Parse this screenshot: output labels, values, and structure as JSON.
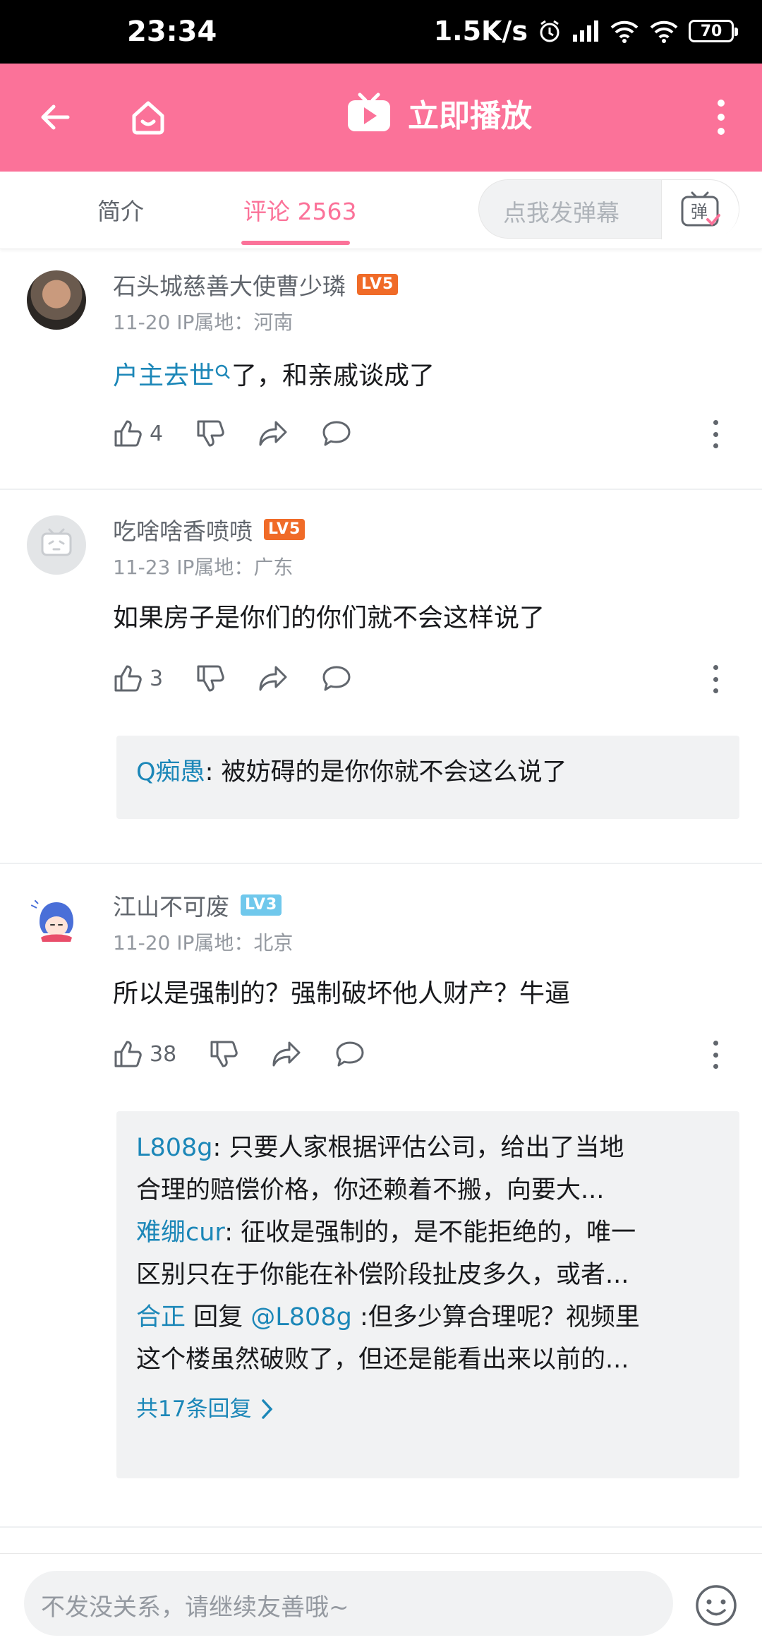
{
  "status_bar": {
    "time": "23:34",
    "net_speed": "1.5K/s",
    "battery": "70"
  },
  "top_bar": {
    "title": "立即播放"
  },
  "tabs": {
    "intro": "简介",
    "comments": "评论 2563",
    "danmaku_placeholder": "点我发弹幕",
    "danmaku_icon_char": "弹"
  },
  "comments": [
    {
      "user": "石头城慈善大使曹少璘",
      "level": "LV5",
      "meta": "11-20  IP属地：河南",
      "content_link": "户主去世",
      "content_rest": "了，和亲戚谈成了",
      "likes": "4"
    },
    {
      "user": "吃啥啥香喷喷",
      "level": "LV5",
      "meta": "11-23  IP属地：广东",
      "content": "如果房子是你们的你们就不会这样说了",
      "likes": "3",
      "replies": [
        {
          "user": "Q痴愚",
          "text": ": 被妨碍的是你你就不会这么说了"
        }
      ]
    },
    {
      "user": "江山不可废",
      "level": "LV3",
      "meta": "11-20  IP属地：北京",
      "content": "所以是强制的？强制破坏他人财产？牛逼",
      "likes": "38",
      "replies": [
        {
          "user": "L808g",
          "line1": ": 只要人家根据评估公司，给出了当地",
          "line2": "合理的赔偿价格，你还赖着不搬，向要大..."
        },
        {
          "user": "难绷cur",
          "line1": ": 征收是强制的，是不能拒绝的，唯一",
          "line2": "区别只在于你能在补偿阶段扯皮多久，或者..."
        },
        {
          "user": "合正",
          "reply_word": " 回复 ",
          "reply_to": "@L808g",
          "line1": " :但多少算合理呢？视频里",
          "line2": "这个楼虽然破败了，但还是能看出来以前的..."
        }
      ],
      "more_replies": "共17条回复"
    }
  ],
  "bottom": {
    "placeholder": "不发没关系，请继续友善哦~"
  },
  "colors": {
    "brand_pink": "#fb7299",
    "link_blue": "#1c87b8",
    "level5": "#f06b28",
    "level3": "#70c8ec"
  }
}
